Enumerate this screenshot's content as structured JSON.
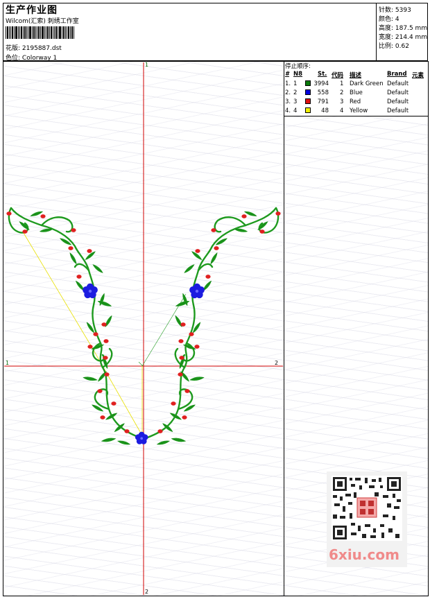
{
  "header": {
    "title": "生产作业图",
    "company": "Wilcom(汇索) 刺绣工作室",
    "design_label": "花版:",
    "design_value": "2195887.dst",
    "colorway_label": "色位:",
    "colorway_value": "Colorway 1"
  },
  "stats": [
    {
      "label": "针数:",
      "value": "5393"
    },
    {
      "label": "颜色:",
      "value": "4"
    },
    {
      "label": "高度:",
      "value": "187.5 mm"
    },
    {
      "label": "宽度:",
      "value": "214.4 mm"
    },
    {
      "label": "比例:",
      "value": "0.62"
    }
  ],
  "sequence": {
    "title": "停止顺序:",
    "headers": [
      "#",
      "N8",
      "St.",
      "代码",
      "描述",
      "Brand",
      "元素"
    ],
    "rows": [
      {
        "idx": "1.",
        "n": "1",
        "st": "3994",
        "code": "1",
        "desc": "Dark Green",
        "brand": "Default",
        "color": "#0a7a0a"
      },
      {
        "idx": "2.",
        "n": "2",
        "st": "558",
        "code": "2",
        "desc": "Blue",
        "brand": "Default",
        "color": "#0000e0"
      },
      {
        "idx": "3.",
        "n": "3",
        "st": "791",
        "code": "3",
        "desc": "Red",
        "brand": "Default",
        "color": "#e01010"
      },
      {
        "idx": "4.",
        "n": "4",
        "st": "48",
        "code": "4",
        "desc": "Yellow",
        "brand": "Default",
        "color": "#f0f000"
      }
    ]
  },
  "axes": {
    "top": "1",
    "bottom": "2",
    "left": "1",
    "right": "2"
  },
  "watermark": {
    "text": "6xiu.com"
  },
  "colors": {
    "axis": "#d00000",
    "leaf": "#1e9a1e",
    "flower": "#1c1ce0",
    "berry": "#e02020",
    "jump": "#e8e000"
  }
}
